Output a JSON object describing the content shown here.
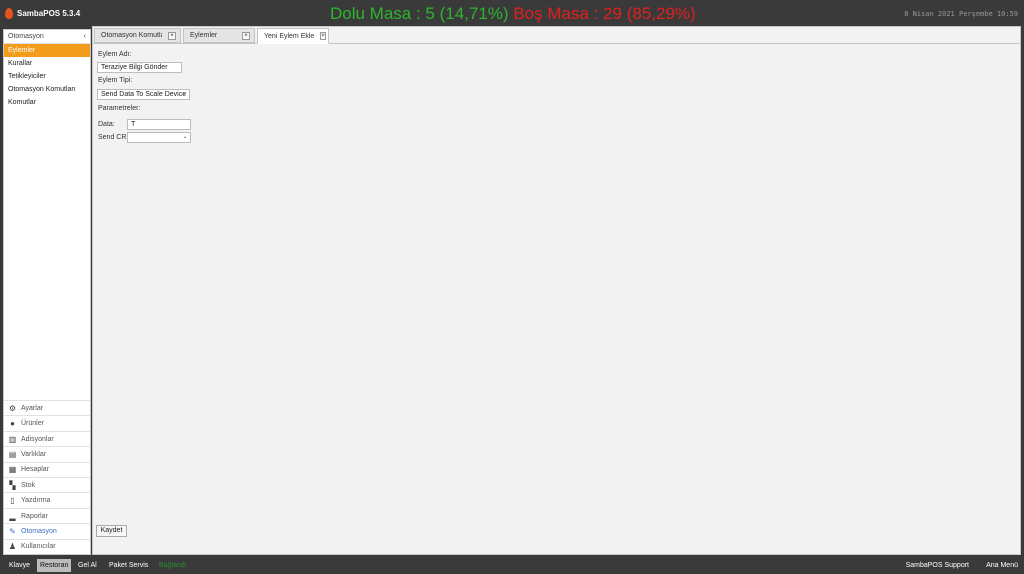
{
  "app": {
    "title": "SambaPOS 5.3.4"
  },
  "status": {
    "occupied": "Dolu Masa : 5  (14,71%)",
    "free": "Boş  Masa : 29  (85,29%)",
    "occupied_color": "#2db52d",
    "free_color": "#e02020"
  },
  "datetime": "8 Nisan 2021 Perşembe 10:59",
  "sidebar": {
    "header": "Otomasyon",
    "collapse_icon": "chevron-left-icon",
    "items": [
      {
        "label": "Eylemler",
        "active": true
      },
      {
        "label": "Kurallar"
      },
      {
        "label": "Tetikleyiciler"
      },
      {
        "label": "Otomasyon Komutları"
      },
      {
        "label": "Komutlar"
      }
    ],
    "modules": [
      {
        "label": "Ayarlar",
        "icon": "gear-icon"
      },
      {
        "label": "Ürünler",
        "icon": "product-icon"
      },
      {
        "label": "Adisyonlar",
        "icon": "tickets-icon"
      },
      {
        "label": "Varlıklar",
        "icon": "entities-icon"
      },
      {
        "label": "Hesaplar",
        "icon": "calculator-icon"
      },
      {
        "label": "Stok",
        "icon": "inventory-icon"
      },
      {
        "label": "Yazdırma",
        "icon": "printer-icon"
      },
      {
        "label": "Raporlar",
        "icon": "reports-icon"
      },
      {
        "label": "Otomasyon",
        "icon": "automation-icon",
        "active": true
      },
      {
        "label": "Kullanıcılar",
        "icon": "user-icon"
      }
    ]
  },
  "tabs": [
    {
      "label": "Otomasyon Komutları"
    },
    {
      "label": "Eylemler"
    },
    {
      "label": "Yeni Eylem Ekle",
      "active": true
    }
  ],
  "form": {
    "action_name_label": "Eylem Adı:",
    "action_name_value": "Teraziye Bilgi Gönder",
    "action_type_label": "Eylem Tipi:",
    "action_type_value": "Send Data To Scale Device",
    "parameters_label": "Parametreler:",
    "data_label": "Data:",
    "data_value": "T",
    "send_cr_label": "Send CR:",
    "send_cr_value": "",
    "save_label": "Kaydet"
  },
  "bottombar": {
    "keyboard": "Klavye",
    "restaurant": "Restoran",
    "takeaway": "Gel Al",
    "delivery": "Paket Servis",
    "connection": "Bağlandı",
    "support": "SambaPOS Support",
    "main_menu": "Ana Menü"
  }
}
